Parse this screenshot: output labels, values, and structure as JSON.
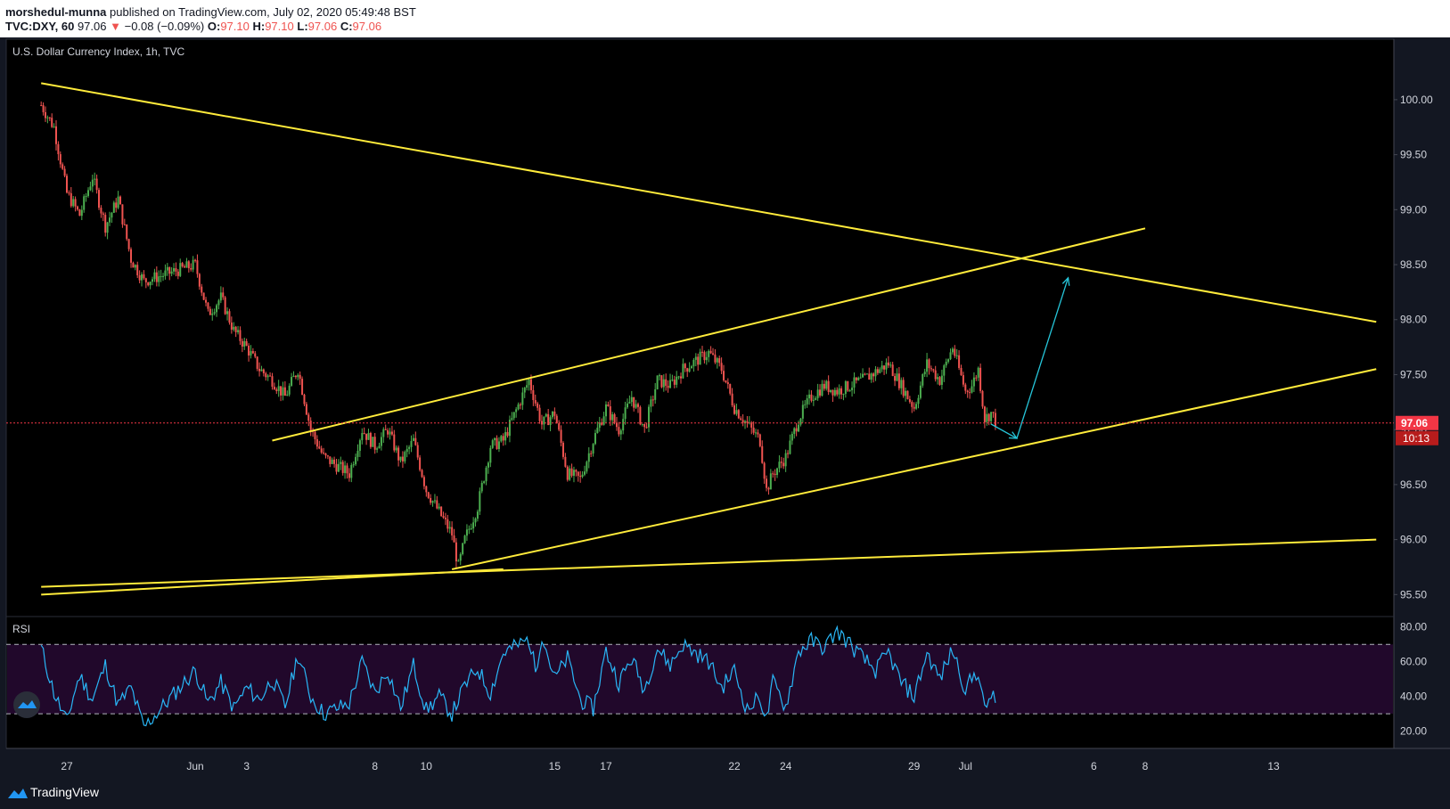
{
  "header": {
    "author": "morshedul-munna",
    "published_text": " published on TradingView.com, July 02, 2020 05:49:48 BST",
    "symbol_line": "TVC:DXY, 60",
    "last_price": "97.06",
    "change": "−0.08 (−0.09%)",
    "open_label": "O:",
    "open": "97.10",
    "high_label": "H:",
    "high": "97.10",
    "low_label": "L:",
    "low": "97.06",
    "close_label": "C:",
    "close": "97.06"
  },
  "footer": {
    "brand": "TradingView"
  },
  "chart_data": {
    "type": "candlestick",
    "title": "U.S. Dollar Currency Index, 1h, TVC",
    "ylim": [
      95.3,
      100.55
    ],
    "y_ticks": [
      "100.00",
      "99.50",
      "99.00",
      "98.50",
      "98.00",
      "97.50",
      "97.00",
      "96.50",
      "96.00",
      "95.50"
    ],
    "y_tick_values": [
      100.0,
      99.5,
      99.0,
      98.5,
      98.0,
      97.5,
      97.0,
      96.5,
      96.0,
      95.5
    ],
    "x_ticks": [
      "27",
      "Jun",
      "3",
      "8",
      "10",
      "15",
      "17",
      "22",
      "24",
      "29",
      "Jul",
      "6",
      "8",
      "13"
    ],
    "price_label": {
      "value": "97.06",
      "countdown": "10:13",
      "color": "#f23645"
    },
    "price_path": [
      [
        "May 26",
        99.95
      ],
      [
        "May 26 12:00",
        99.75
      ],
      [
        "May 27",
        99.15
      ],
      [
        "May 27 12:00",
        98.95
      ],
      [
        "May 28",
        99.3
      ],
      [
        "May 28 12:00",
        98.85
      ],
      [
        "May 29",
        99.1
      ],
      [
        "May 29 12:00",
        98.55
      ],
      [
        "May 30",
        98.35
      ],
      [
        "Jun 1",
        98.5
      ],
      [
        "Jun 1 12:00",
        98.05
      ],
      [
        "Jun 2",
        98.2
      ],
      [
        "Jun 2 12:00",
        97.9
      ],
      [
        "Jun 3",
        97.75
      ],
      [
        "Jun 3 12:00",
        97.55
      ],
      [
        "Jun 4",
        97.45
      ],
      [
        "Jun 4 12:00",
        97.3
      ],
      [
        "Jun 5",
        97.55
      ],
      [
        "Jun 5 12:00",
        97.0
      ],
      [
        "Jun 6",
        96.75
      ],
      [
        "Jun 7",
        96.6
      ],
      [
        "Jun 7 12:00",
        97.0
      ],
      [
        "Jun 8",
        96.85
      ],
      [
        "Jun 8 12:00",
        97.0
      ],
      [
        "Jun 9",
        96.7
      ],
      [
        "Jun 9 12:00",
        96.9
      ],
      [
        "Jun 10",
        96.45
      ],
      [
        "Jun 10 12:00",
        96.25
      ],
      [
        "Jun 11",
        96.05
      ],
      [
        "Jun 11 06:00",
        95.75
      ],
      [
        "Jun 11 12:00",
        96.0
      ],
      [
        "Jun 12",
        96.3
      ],
      [
        "Jun 12 12:00",
        96.85
      ],
      [
        "Jun 13",
        96.9
      ],
      [
        "Jun 14",
        97.45
      ],
      [
        "Jun 14 12:00",
        97.05
      ],
      [
        "Jun 15",
        97.15
      ],
      [
        "Jun 15 12:00",
        96.6
      ],
      [
        "Jun 16",
        96.55
      ],
      [
        "Jun 16 12:00",
        96.9
      ],
      [
        "Jun 17",
        97.2
      ],
      [
        "Jun 17 12:00",
        97.0
      ],
      [
        "Jun 18",
        97.3
      ],
      [
        "Jun 18 12:00",
        97.0
      ],
      [
        "Jun 19",
        97.45
      ],
      [
        "Jun 19 12:00",
        97.4
      ],
      [
        "Jun 20",
        97.55
      ],
      [
        "Jun 21",
        97.7
      ],
      [
        "Jun 21 12:00",
        97.55
      ],
      [
        "Jun 22",
        97.2
      ],
      [
        "Jun 22 12:00",
        97.05
      ],
      [
        "Jun 23",
        96.9
      ],
      [
        "Jun 23 06:00",
        96.45
      ],
      [
        "Jun 23 12:00",
        96.6
      ],
      [
        "Jun 24",
        96.75
      ],
      [
        "Jun 24 12:00",
        97.1
      ],
      [
        "Jun 25",
        97.3
      ],
      [
        "Jun 25 12:00",
        97.4
      ],
      [
        "Jun 26",
        97.35
      ],
      [
        "Jun 27",
        97.45
      ],
      [
        "Jun 28",
        97.6
      ],
      [
        "Jun 28 12:00",
        97.4
      ],
      [
        "Jun 29",
        97.2
      ],
      [
        "Jun 29 12:00",
        97.6
      ],
      [
        "Jun 30",
        97.45
      ],
      [
        "Jun 30 12:00",
        97.75
      ],
      [
        "Jul 1",
        97.35
      ],
      [
        "Jul 1 06:00",
        97.4
      ],
      [
        "Jul 1 12:00",
        97.55
      ],
      [
        "Jul 1 18:00",
        97.1
      ],
      [
        "Jul 2",
        97.15
      ],
      [
        "Jul 2 05:00",
        97.06
      ]
    ],
    "trendlines": [
      {
        "color": "#ffeb3b",
        "from": [
          "May 26",
          100.15
        ],
        "to": [
          "Jul 17",
          97.98
        ]
      },
      {
        "color": "#ffeb3b",
        "from": [
          "Jun 4",
          96.9
        ],
        "to": [
          "Jul 8",
          98.83
        ]
      },
      {
        "color": "#ffeb3b",
        "from": [
          "Jun 11",
          95.73
        ],
        "to": [
          "Jul 17",
          97.55
        ]
      },
      {
        "color": "#ffeb3b",
        "from": [
          "May 26",
          95.57
        ],
        "to": [
          "Jul 17",
          96.0
        ]
      },
      {
        "color": "#ffeb3b",
        "from": [
          "May 26",
          95.5
        ],
        "to": [
          "Jun 13",
          95.73
        ]
      }
    ],
    "projection_arrows": [
      {
        "color": "#26c6da",
        "from": [
          "Jul 2",
          97.05
        ],
        "to": [
          "Jul 3",
          96.92
        ]
      },
      {
        "color": "#26c6da",
        "from": [
          "Jul 3",
          96.92
        ],
        "to": [
          "Jul 5",
          98.38
        ]
      }
    ],
    "rsi": {
      "label": "RSI",
      "ylim": [
        10,
        85
      ],
      "y_ticks": [
        "80.00",
        "60.00",
        "40.00",
        "20.00"
      ],
      "y_tick_values": [
        80,
        60,
        40,
        20
      ],
      "band": [
        30,
        70
      ],
      "line_color": "#29b6f6",
      "band_color": "#21082b",
      "values": [
        [
          "May 26",
          68
        ],
        [
          "May 26 12:00",
          42
        ],
        [
          "May 27",
          25
        ],
        [
          "May 27 06:00",
          40
        ],
        [
          "May 27 12:00",
          52
        ],
        [
          "May 28",
          38
        ],
        [
          "May 28 12:00",
          58
        ],
        [
          "May 29",
          35
        ],
        [
          "May 29 12:00",
          45
        ],
        [
          "May 30",
          22
        ],
        [
          "Jun 1",
          55
        ],
        [
          "Jun 1 12:00",
          36
        ],
        [
          "Jun 2",
          48
        ],
        [
          "Jun 2 12:00",
          33
        ],
        [
          "Jun 3",
          45
        ],
        [
          "Jun 3 12:00",
          38
        ],
        [
          "Jun 4",
          50
        ],
        [
          "Jun 4 12:00",
          34
        ],
        [
          "Jun 5",
          64
        ],
        [
          "Jun 5 12:00",
          40
        ],
        [
          "Jun 6",
          30
        ],
        [
          "Jun 7",
          36
        ],
        [
          "Jun 7 12:00",
          60
        ],
        [
          "Jun 8",
          42
        ],
        [
          "Jun 8 12:00",
          55
        ],
        [
          "Jun 9",
          33
        ],
        [
          "Jun 9 12:00",
          58
        ],
        [
          "Jun 10",
          32
        ],
        [
          "Jun 10 12:00",
          40
        ],
        [
          "Jun 11",
          30
        ],
        [
          "Jun 11 12:00",
          46
        ],
        [
          "Jun 12",
          56
        ],
        [
          "Jun 12 12:00",
          42
        ],
        [
          "Jun 13",
          65
        ],
        [
          "Jun 14",
          73
        ],
        [
          "Jun 14 06:00",
          55
        ],
        [
          "Jun 14 12:00",
          76
        ],
        [
          "Jun 15",
          50
        ],
        [
          "Jun 15 12:00",
          62
        ],
        [
          "Jun 16",
          38
        ],
        [
          "Jun 16 12:00",
          33
        ],
        [
          "Jun 17",
          66
        ],
        [
          "Jun 17 12:00",
          48
        ],
        [
          "Jun 18",
          62
        ],
        [
          "Jun 18 12:00",
          44
        ],
        [
          "Jun 19",
          68
        ],
        [
          "Jun 19 12:00",
          58
        ],
        [
          "Jun 20",
          70
        ],
        [
          "Jun 21",
          60
        ],
        [
          "Jun 21 12:00",
          45
        ],
        [
          "Jun 22",
          55
        ],
        [
          "Jun 22 12:00",
          32
        ],
        [
          "Jun 23",
          40
        ],
        [
          "Jun 23 06:00",
          26
        ],
        [
          "Jun 23 12:00",
          48
        ],
        [
          "Jun 24",
          34
        ],
        [
          "Jun 24 12:00",
          66
        ],
        [
          "Jun 25",
          72
        ],
        [
          "Jun 25 12:00",
          68
        ],
        [
          "Jun 26",
          78
        ],
        [
          "Jun 27",
          62
        ],
        [
          "Jun 27 12:00",
          55
        ],
        [
          "Jun 28",
          65
        ],
        [
          "Jun 28 12:00",
          48
        ],
        [
          "Jun 29",
          40
        ],
        [
          "Jun 29 12:00",
          65
        ],
        [
          "Jun 30",
          50
        ],
        [
          "Jun 30 12:00",
          67
        ],
        [
          "Jul 1",
          44
        ],
        [
          "Jul 1 06:00",
          50
        ],
        [
          "Jul 1 12:00",
          55
        ],
        [
          "Jul 1 18:00",
          31
        ],
        [
          "Jul 2",
          42
        ],
        [
          "Jul 2 05:00",
          33
        ]
      ]
    },
    "grid": false,
    "legend_position": "top-left"
  }
}
